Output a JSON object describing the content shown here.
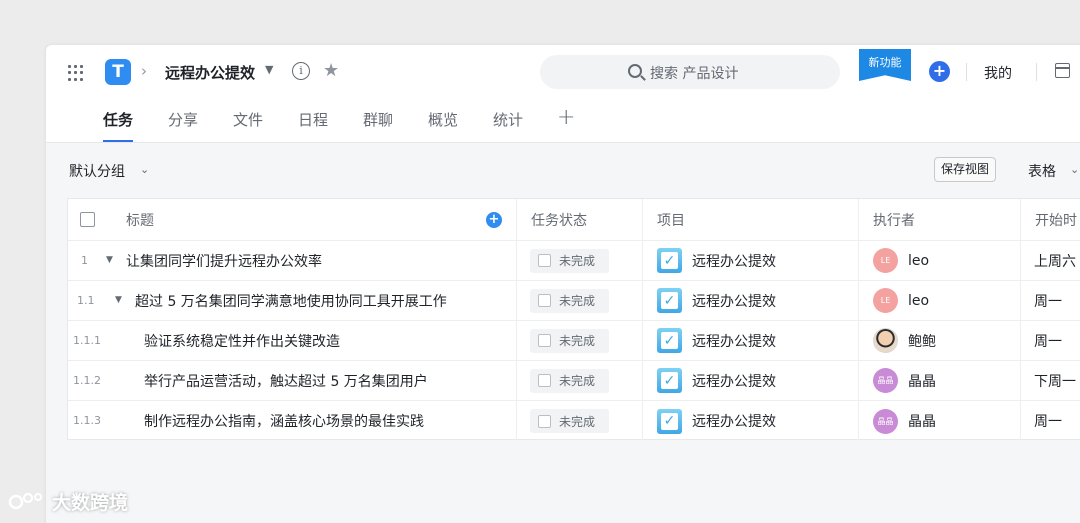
{
  "header": {
    "app_logo_letter": "T",
    "project_title": "远程办公提效",
    "search_placeholder": "搜索 产品设计",
    "new_feature_badge": "新功能",
    "add_label": "+",
    "mine_label": "我的"
  },
  "tabs": [
    {
      "label": "任务",
      "active": true
    },
    {
      "label": "分享",
      "active": false
    },
    {
      "label": "文件",
      "active": false
    },
    {
      "label": "日程",
      "active": false
    },
    {
      "label": "群聊",
      "active": false
    },
    {
      "label": "概览",
      "active": false
    },
    {
      "label": "统计",
      "active": false
    }
  ],
  "tab_add_label": "+",
  "toolbar": {
    "group_label": "默认分组",
    "save_view_label": "保存视图",
    "view_label": "表格"
  },
  "table": {
    "columns": {
      "title": "标题",
      "status": "任务状态",
      "project": "项目",
      "assignee": "执行者",
      "start": "开始时"
    },
    "rows": [
      {
        "num": "1",
        "expandable": true,
        "title": "让集团同学们提升远程办公效率",
        "status": "未完成",
        "project": "远程办公提效",
        "assignee": "leo",
        "avatar": "LE",
        "avatar_color": "#f3a29f",
        "start": "上周六"
      },
      {
        "num": "1.1",
        "expandable": true,
        "title": "超过 5 万名集团同学满意地使用协同工具开展工作",
        "status": "未完成",
        "project": "远程办公提效",
        "assignee": "leo",
        "avatar": "LE",
        "avatar_color": "#f3a29f",
        "start": "周一"
      },
      {
        "num": "1.1.1",
        "expandable": false,
        "title": "验证系统稳定性并作出关键改造",
        "status": "未完成",
        "project": "远程办公提效",
        "assignee": "鲍鲍",
        "avatar": "",
        "avatar_color": "photo",
        "start": "周一"
      },
      {
        "num": "1.1.2",
        "expandable": false,
        "title": "举行产品运营活动，触达超过 5 万名集团用户",
        "status": "未完成",
        "project": "远程办公提效",
        "assignee": "晶晶",
        "avatar": "晶晶",
        "avatar_color": "#c98bd6",
        "start": "下周一"
      },
      {
        "num": "1.1.3",
        "expandable": false,
        "title": "制作远程办公指南，涵盖核心场景的最佳实践",
        "status": "未完成",
        "project": "远程办公提效",
        "assignee": "晶晶",
        "avatar": "晶晶",
        "avatar_color": "#c98bd6",
        "start": "周一"
      }
    ]
  },
  "watermark": "大数跨境",
  "colors": {
    "accent": "#2f6ee8",
    "logo": "#2f8cf0",
    "badge": "#1e88e5"
  },
  "icons": {
    "app_grid": "grid-icon",
    "breadcrumb": "chevron-right-icon",
    "dropdown": "caret-down-icon",
    "info": "info-icon",
    "favorite": "star-icon",
    "search": "search-icon",
    "add": "plus-circle-icon",
    "calendar": "calendar-icon",
    "status": "checkbox-icon",
    "project": "checkbox-checked-icon"
  }
}
